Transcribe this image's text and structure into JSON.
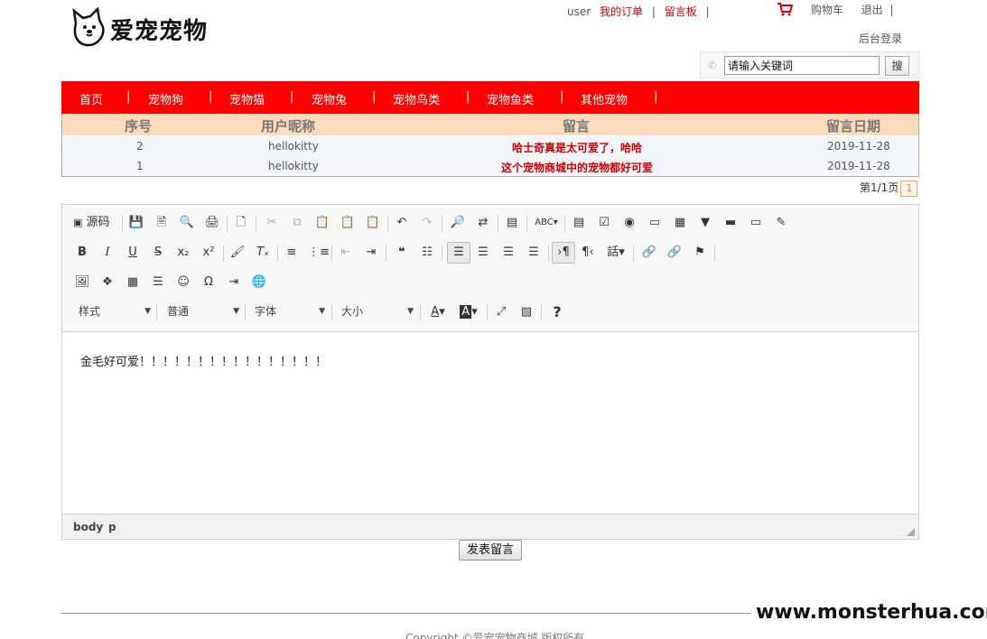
{
  "header": {
    "logo_text": "爱宠宠物",
    "user_label": "user",
    "my_orders": "我的订单",
    "separator": "|",
    "guestbook": "留言板",
    "cart": "购物车",
    "logout": "退出",
    "admin_login": "后台登录"
  },
  "search": {
    "value": "请输入关键词",
    "button": "搜"
  },
  "nav": {
    "items": [
      "首页",
      "宠物狗",
      "宠物猫",
      "宠物兔",
      "宠物鸟类",
      "宠物鱼类",
      "其他宠物"
    ],
    "separator": "|"
  },
  "messages": {
    "columns": [
      "序号",
      "用户昵称",
      "留言",
      "留言日期"
    ],
    "rows": [
      {
        "id": "2",
        "user": "hellokitty",
        "message": "哈士奇真是太可爱了，哈哈",
        "date": "2019-11-28"
      },
      {
        "id": "1",
        "user": "hellokitty",
        "message": "这个宠物商城中的宠物都好可爱",
        "date": "2019-11-28"
      }
    ],
    "pager_text": "第1/1页",
    "current_page": "1"
  },
  "editor": {
    "source_label": "源码",
    "combos": [
      "样式",
      "普通",
      "字体",
      "大小"
    ],
    "content": "金毛好可爱！！！！！！！！！！！！！！！！",
    "path": [
      "body",
      "p"
    ]
  },
  "submit_label": "发表留言",
  "copyright": "Copyright ©爱宠宠物商城 版权所有",
  "watermark": "www.monsterhua.com",
  "colors": {
    "nav_bg": "#ff0000",
    "table_header_bg": "#fddcbc",
    "link_red": "#cc0000"
  }
}
